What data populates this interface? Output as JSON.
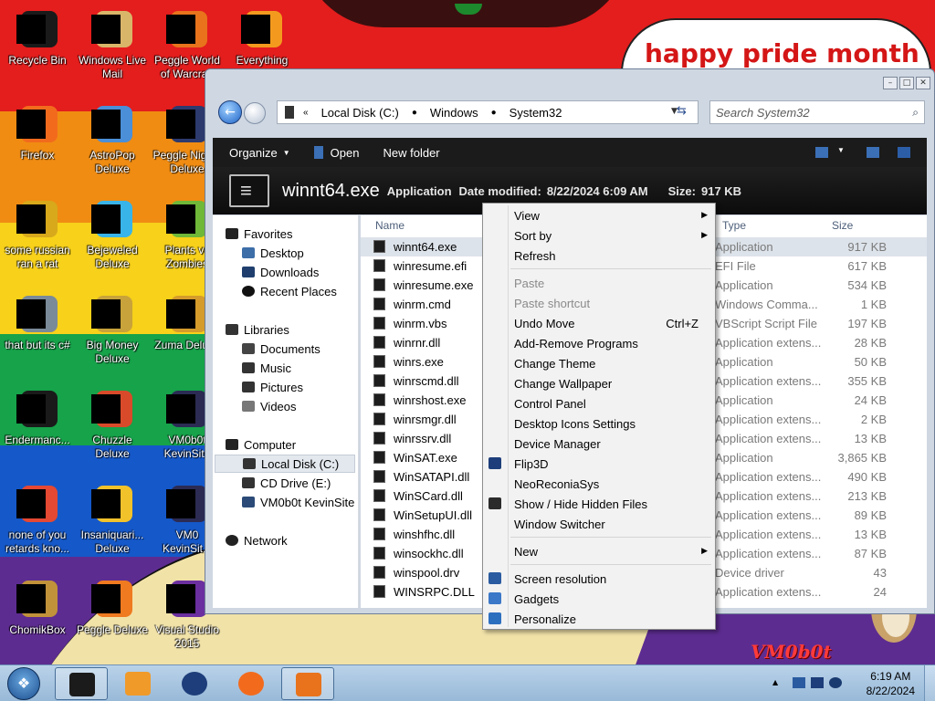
{
  "wallpaper": {
    "bands": [
      "#e41d1d",
      "#f08c12",
      "#f7d11a",
      "#16a34a",
      "#1558c9",
      "#5d2c91"
    ],
    "banner_text": "happy pride month",
    "logo_text": "VM0b0t"
  },
  "desktop_icons": [
    {
      "label": "Recycle Bin",
      "icon": "recycle-bin-icon",
      "color": "#1a1a1a"
    },
    {
      "label": "Windows Live Mail",
      "icon": "mail-icon",
      "color": "#d9b56a"
    },
    {
      "label": "Peggle World of Warcraft",
      "icon": "peggle-wow-icon",
      "color": "#e8731c"
    },
    {
      "label": "Everything",
      "icon": "everything-icon",
      "color": "#f39a1e"
    },
    {
      "label": "Firefox",
      "icon": "firefox-icon",
      "color": "#f26b1d"
    },
    {
      "label": "AstroPop Deluxe",
      "icon": "astropop-icon",
      "color": "#4a8fd8"
    },
    {
      "label": "Peggle Nights Deluxe",
      "icon": "peggle-nights-icon",
      "color": "#2c3a6e"
    },
    {
      "label": "some russian ran a rat",
      "icon": "document-icon",
      "color": "#d7a91b"
    },
    {
      "label": "Bejeweled Deluxe",
      "icon": "bejeweled-icon",
      "color": "#38b4e8"
    },
    {
      "label": "Plants vs Zombies",
      "icon": "pvz-icon",
      "color": "#6fb838"
    },
    {
      "label": "that but its c#",
      "icon": "windows-icon",
      "color": "#7a8a99"
    },
    {
      "label": "Big Money Deluxe",
      "icon": "big-money-icon",
      "color": "#c8a23a"
    },
    {
      "label": "Zuma Deluxe",
      "icon": "zuma-icon",
      "color": "#d59b2b"
    },
    {
      "label": "Endermanc...",
      "icon": "console-icon",
      "color": "#1a1a1a"
    },
    {
      "label": "Chuzzle Deluxe",
      "icon": "chuzzle-icon",
      "color": "#d94a2a"
    },
    {
      "label": "VM0b0t KevinSite",
      "icon": "shortcut-icon",
      "color": "#2b2b54"
    },
    {
      "label": "none of you retards kno...",
      "icon": "mouse-icon",
      "color": "#e54833"
    },
    {
      "label": "Insaniquari... Deluxe",
      "icon": "insaniquarium-icon",
      "color": "#f2c22b"
    },
    {
      "label": "VM0 KevinSit...",
      "icon": "shortcut-icon",
      "color": "#2b2b54"
    },
    {
      "label": "ChomikBox",
      "icon": "chomikbox-icon",
      "color": "#c1923a"
    },
    {
      "label": "Peggle Deluxe",
      "icon": "peggle-icon",
      "color": "#ef7a20"
    },
    {
      "label": "Visual Studio 2015",
      "icon": "visual-studio-icon",
      "color": "#6b2fa0"
    }
  ],
  "explorer": {
    "breadcrumb": [
      "Local Disk (C:)",
      "Windows",
      "System32"
    ],
    "search_placeholder": "Search System32",
    "toolbar": {
      "organize": "Organize",
      "open": "Open",
      "new_folder": "New folder"
    },
    "details": {
      "name": "winnt64.exe",
      "type": "Application",
      "modified_label": "Date modified:",
      "modified_value": "8/22/2024 6:09 AM",
      "size_label": "Size:",
      "size_value": "917 KB"
    },
    "nav": {
      "favorites": "Favorites",
      "desktop": "Desktop",
      "downloads": "Downloads",
      "recent": "Recent Places",
      "libraries": "Libraries",
      "documents": "Documents",
      "music": "Music",
      "pictures": "Pictures",
      "videos": "Videos",
      "computer": "Computer",
      "local_disk": "Local Disk (C:)",
      "cd_drive": "CD Drive (E:)",
      "vm_site": "VM0b0t KevinSite",
      "network": "Network"
    },
    "columns": {
      "name": "Name",
      "type": "Type",
      "size": "Size"
    },
    "files": [
      {
        "name": "winnt64.exe",
        "type": "Application",
        "size": "917 KB"
      },
      {
        "name": "winresume.efi",
        "type": "EFI File",
        "size": "617 KB"
      },
      {
        "name": "winresume.exe",
        "type": "Application",
        "size": "534 KB"
      },
      {
        "name": "winrm.cmd",
        "type": "Windows Comma...",
        "size": "1 KB"
      },
      {
        "name": "winrm.vbs",
        "type": "VBScript Script File",
        "size": "197 KB"
      },
      {
        "name": "winrnr.dll",
        "type": "Application extens...",
        "size": "28 KB"
      },
      {
        "name": "winrs.exe",
        "type": "Application",
        "size": "50 KB"
      },
      {
        "name": "winrscmd.dll",
        "type": "Application extens...",
        "size": "355 KB"
      },
      {
        "name": "winrshost.exe",
        "type": "Application",
        "size": "24 KB"
      },
      {
        "name": "winrsmgr.dll",
        "type": "Application extens...",
        "size": "2 KB"
      },
      {
        "name": "winrssrv.dll",
        "type": "Application extens...",
        "size": "13 KB"
      },
      {
        "name": "WinSAT.exe",
        "type": "Application",
        "size": "3,865 KB"
      },
      {
        "name": "WinSATAPI.dll",
        "type": "Application extens...",
        "size": "490 KB"
      },
      {
        "name": "WinSCard.dll",
        "type": "Application extens...",
        "size": "213 KB"
      },
      {
        "name": "WinSetupUI.dll",
        "type": "Application extens...",
        "size": "89 KB"
      },
      {
        "name": "winshfhc.dll",
        "type": "Application extens...",
        "size": "13 KB"
      },
      {
        "name": "winsockhc.dll",
        "type": "Application extens...",
        "size": "87 KB"
      },
      {
        "name": "winspool.drv",
        "type": "Device driver",
        "size": "43"
      },
      {
        "name": "WINSRPC.DLL",
        "type": "Application extens...",
        "size": "24"
      }
    ]
  },
  "context_menu": [
    {
      "label": "View",
      "arrow": true
    },
    {
      "label": "Sort by",
      "arrow": true
    },
    {
      "label": "Refresh"
    },
    {
      "separator": true
    },
    {
      "label": "Paste",
      "disabled": true
    },
    {
      "label": "Paste shortcut",
      "disabled": true
    },
    {
      "label": "Undo Move",
      "shortcut": "Ctrl+Z"
    },
    {
      "label": "Add-Remove Programs"
    },
    {
      "label": "Change Theme"
    },
    {
      "label": "Change Wallpaper"
    },
    {
      "label": "Control Panel"
    },
    {
      "label": "Desktop Icons Settings"
    },
    {
      "label": "Device Manager"
    },
    {
      "label": "Flip3D",
      "icon": "flip3d-icon"
    },
    {
      "label": "NeoReconiaSys"
    },
    {
      "label": "Show / Hide Hidden Files",
      "icon": "hidden-files-icon"
    },
    {
      "label": "Window Switcher"
    },
    {
      "separator": true
    },
    {
      "label": "New",
      "arrow": true
    },
    {
      "separator": true
    },
    {
      "label": "Screen resolution",
      "icon": "monitor-icon"
    },
    {
      "label": "Gadgets",
      "icon": "gadgets-icon"
    },
    {
      "label": "Personalize",
      "icon": "personalize-icon"
    }
  ],
  "taskbar": {
    "clock_time": "6:19 AM",
    "clock_date": "8/22/2024",
    "buttons": [
      {
        "icon": "explorer-icon",
        "color": "#1b1b1b",
        "active": true
      },
      {
        "icon": "media-player-icon",
        "color": "#f09a2a"
      },
      {
        "icon": "globe-icon",
        "color": "#1d3e7a"
      },
      {
        "icon": "firefox-icon",
        "color": "#f26b1d"
      },
      {
        "icon": "peggle-icon",
        "color": "#e8731c",
        "active": true
      }
    ]
  }
}
